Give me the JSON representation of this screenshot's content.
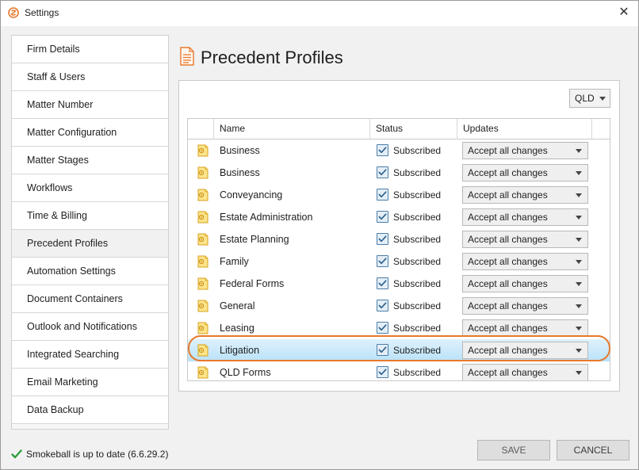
{
  "window": {
    "title": "Settings"
  },
  "sidebar": {
    "items": [
      {
        "label": "Firm Details"
      },
      {
        "label": "Staff & Users"
      },
      {
        "label": "Matter Number"
      },
      {
        "label": "Matter Configuration"
      },
      {
        "label": "Matter Stages"
      },
      {
        "label": "Workflows"
      },
      {
        "label": "Time & Billing"
      },
      {
        "label": "Precedent Profiles",
        "active": true
      },
      {
        "label": "Automation Settings"
      },
      {
        "label": "Document Containers"
      },
      {
        "label": "Outlook and Notifications"
      },
      {
        "label": "Integrated Searching"
      },
      {
        "label": "Email Marketing"
      },
      {
        "label": "Data Backup"
      }
    ]
  },
  "main": {
    "title": "Precedent Profiles",
    "state_select": {
      "value": "QLD"
    },
    "grid": {
      "columns": [
        "Name",
        "Status",
        "Updates"
      ],
      "rows": [
        {
          "name": "Business",
          "status": "Subscribed",
          "update": "Accept all changes"
        },
        {
          "name": "Business",
          "status": "Subscribed",
          "update": "Accept all changes"
        },
        {
          "name": "Conveyancing",
          "status": "Subscribed",
          "update": "Accept all changes"
        },
        {
          "name": "Estate Administration",
          "status": "Subscribed",
          "update": "Accept all changes"
        },
        {
          "name": "Estate Planning",
          "status": "Subscribed",
          "update": "Accept all changes"
        },
        {
          "name": "Family",
          "status": "Subscribed",
          "update": "Accept all changes"
        },
        {
          "name": "Federal Forms",
          "status": "Subscribed",
          "update": "Accept all changes"
        },
        {
          "name": "General",
          "status": "Subscribed",
          "update": "Accept all changes"
        },
        {
          "name": "Leasing",
          "status": "Subscribed",
          "update": "Accept all changes"
        },
        {
          "name": "Litigation",
          "status": "Subscribed",
          "update": "Accept all changes",
          "selected": true
        },
        {
          "name": "QLD Forms",
          "status": "Subscribed",
          "update": "Accept all changes"
        }
      ]
    }
  },
  "footer": {
    "status_text": "Smokeball is up to date (6.6.29.2)",
    "save_label": "SAVE",
    "cancel_label": "CANCEL"
  },
  "colors": {
    "accent_orange": "#e8792c",
    "selected_row": "#b9e2f9",
    "check_green": "#2e9e3f",
    "checkbox_blue": "#4b7ea8"
  },
  "icons": {
    "app": "smokeball-logo-icon",
    "page": "document-icon",
    "row": "precedent-folder-icon",
    "close": "close-icon"
  }
}
